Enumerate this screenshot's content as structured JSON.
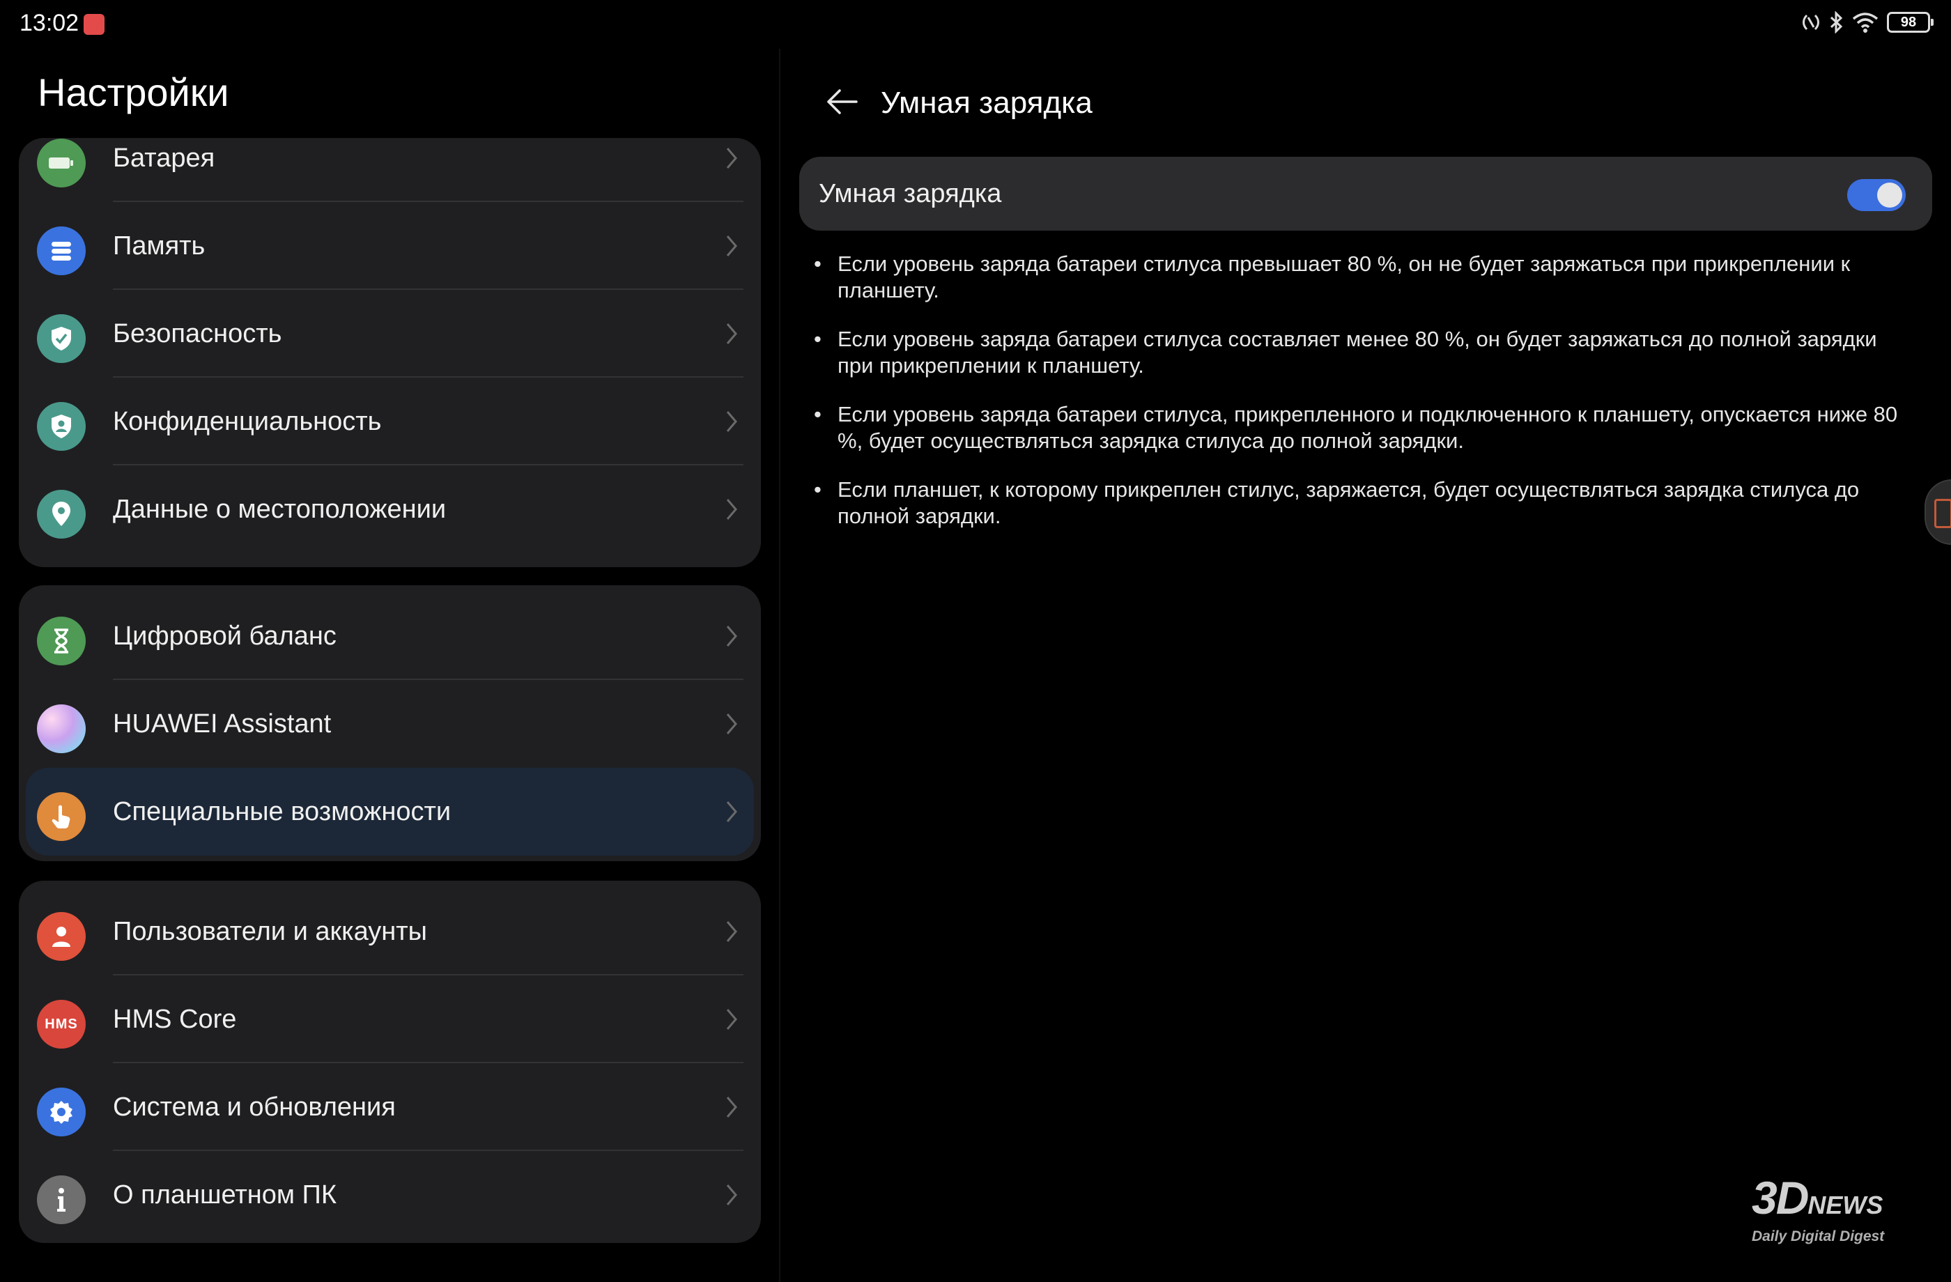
{
  "status_bar": {
    "time": "13:02",
    "battery": "98"
  },
  "left": {
    "title": "Настройки",
    "groups": [
      {
        "items": [
          {
            "label": "Батарея",
            "icon": "battery-icon",
            "color": "#4f9a55"
          },
          {
            "label": "Память",
            "icon": "storage-icon",
            "color": "#3a73e0"
          },
          {
            "label": "Безопасность",
            "icon": "shield-check-icon",
            "color": "#4a9a8c"
          },
          {
            "label": "Конфиденциальность",
            "icon": "privacy-shield-icon",
            "color": "#4a9a8c"
          },
          {
            "label": "Данные о местоположении",
            "icon": "location-icon",
            "color": "#4a9a8c"
          }
        ]
      },
      {
        "items": [
          {
            "label": "Цифровой баланс",
            "icon": "hourglass-icon",
            "color": "#4f9a55"
          },
          {
            "label": "HUAWEI Assistant",
            "icon": "assistant-icon",
            "color": "#c79be8"
          },
          {
            "label": "Специальные возможности",
            "icon": "hand-icon",
            "color": "#e08a3c",
            "active": true
          }
        ]
      },
      {
        "items": [
          {
            "label": "Пользователи и аккаунты",
            "icon": "user-icon",
            "color": "#e0523c"
          },
          {
            "label": "HMS Core",
            "icon": "hms-icon",
            "color": "#d9463c",
            "badge": "HMS"
          },
          {
            "label": "Система и обновления",
            "icon": "gear-icon",
            "color": "#3a73e0"
          },
          {
            "label": "О планшетном ПК",
            "icon": "info-icon",
            "color": "#6f6f6f"
          }
        ]
      }
    ]
  },
  "right": {
    "title": "Умная зарядка",
    "toggle": {
      "label": "Умная зарядка",
      "on": true
    },
    "bullets": [
      "Если уровень заряда батареи стилуса превышает 80 %, он не будет заряжаться при прикреплении к планшету.",
      "Если уровень заряда батареи стилуса составляет менее 80 %, он будет заряжаться до полной зарядки при прикреплении к планшету.",
      "Если уровень заряда батареи стилуса, прикрепленного и подключенного к планшету, опускается ниже 80 %, будет осуществляться зарядка стилуса до полной зарядки.",
      "Если планшет, к которому прикреплен стилус, заряжается, будет осуществляться зарядка стилуса до полной зарядки."
    ]
  },
  "watermark": {
    "logo": "3D",
    "logo_suffix": "NEWS",
    "tagline": "Daily Digital Digest"
  },
  "accent": "#3b6fe0"
}
